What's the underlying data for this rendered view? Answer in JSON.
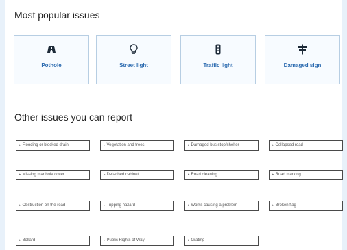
{
  "popular": {
    "title": "Most popular issues",
    "tiles": [
      {
        "label": "Pothole",
        "icon": "car-icon"
      },
      {
        "label": "Street light",
        "icon": "lightbulb-icon"
      },
      {
        "label": "Traffic light",
        "icon": "traffic-light-icon"
      },
      {
        "label": "Damaged sign",
        "icon": "signpost-icon"
      }
    ]
  },
  "other": {
    "title": "Other issues you can report",
    "items": [
      "Flooding or blocked drain",
      "Vegetation and trees",
      "Damaged bus stop/shelter",
      "Collapsed road",
      "Missing manhole cover",
      "Detached cabinet",
      "Road cleaning",
      "Road marking",
      "Obstruction on the road",
      "Tripping hazard",
      "Works causing a problem",
      "Broken flag",
      "Bollard",
      "Public Rights of Way",
      "Grating"
    ]
  },
  "colors": {
    "page_background": "#e8f1fa",
    "tile_border": "#b7cee3",
    "link_blue": "#2c6bb0"
  }
}
